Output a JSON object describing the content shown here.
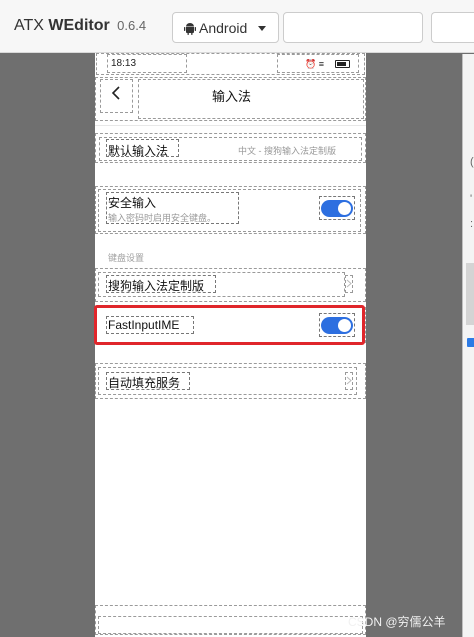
{
  "app": {
    "name_prefix": "ATX",
    "name_main": "WEditor",
    "version": "0.6.4"
  },
  "toolbar": {
    "platform_selected": "Android",
    "platform_icon": "android-icon"
  },
  "device": {
    "status_bar": {
      "time": "18:13",
      "icons": "⏰ ≡"
    },
    "header": {
      "title": "输入法",
      "back_icon": "chevron-left-icon"
    },
    "items": {
      "default_ime": {
        "label": "默认输入法",
        "value": "中文 - 搜狗输入法定制版"
      },
      "secure_input": {
        "label": "安全输入",
        "description": "输入密码时启用安全键盘。",
        "enabled": true
      },
      "keyboard_section": "键盘设置",
      "sogou": {
        "label": "搜狗输入法定制版"
      },
      "fastinput": {
        "label": "FastInputIME",
        "enabled": true
      },
      "autofill": {
        "label": "自动填充服务"
      }
    }
  },
  "right_panel": {
    "mark_1": "(",
    "mark_2": "'",
    "mark_3": ":",
    "mark_4": "f"
  },
  "colors": {
    "toggle_on": "#2d6fe0",
    "highlight": "#e0262b",
    "canvas_bg": "#6f6f6f"
  },
  "watermark": "CSDN @穷儒公羊"
}
